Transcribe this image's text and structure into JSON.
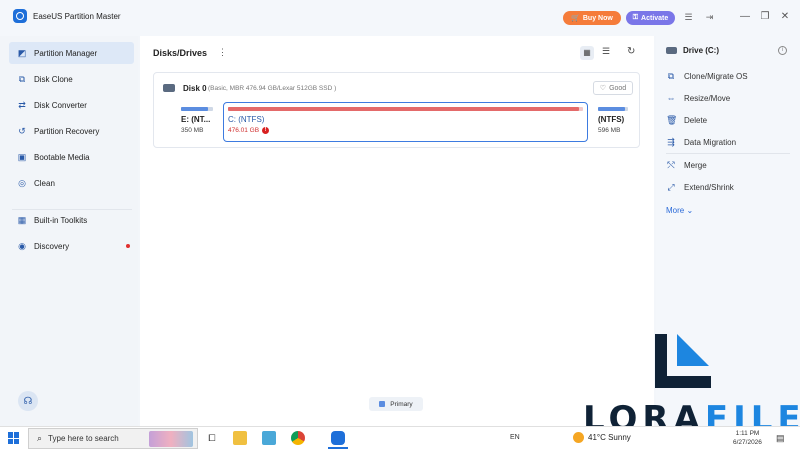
{
  "window": {
    "title": "EaseUS Partition Master",
    "buy_label": "Buy Now",
    "activate_label": "Activate"
  },
  "sidebar": {
    "items": [
      {
        "label": "Partition Manager",
        "icon": "partition-icon"
      },
      {
        "label": "Disk Clone",
        "icon": "clone-icon"
      },
      {
        "label": "Disk Converter",
        "icon": "converter-icon"
      },
      {
        "label": "Partition Recovery",
        "icon": "recovery-icon"
      },
      {
        "label": "Bootable Media",
        "icon": "media-icon"
      },
      {
        "label": "Clean",
        "icon": "clean-icon"
      },
      {
        "label": "Built-in Toolkits",
        "icon": "toolkit-icon"
      },
      {
        "label": "Discovery",
        "icon": "discovery-icon"
      }
    ]
  },
  "main": {
    "title": "Disks/Drives",
    "disk": {
      "name": "Disk 0",
      "info": "(Basic, MBR 476.94 GB/Lexar 512GB SSD )",
      "status": "Good",
      "partitions": [
        {
          "label": "E: (NT...",
          "size": "350 MB",
          "used": 0.85
        },
        {
          "label": "C: (NTFS)",
          "size": "476.01 GB",
          "used": 0.99
        },
        {
          "label": "(NTFS)",
          "size": "596 MB",
          "used": 0.9
        }
      ]
    },
    "legend": "Primary"
  },
  "right_panel": {
    "drive": "Drive (C:)",
    "actions": [
      {
        "label": "Clone/Migrate OS",
        "icon": "clone-os-icon"
      },
      {
        "label": "Resize/Move",
        "icon": "resize-icon"
      },
      {
        "label": "Delete",
        "icon": "trash-icon"
      },
      {
        "label": "Data Migration",
        "icon": "migration-icon"
      },
      {
        "label": "Merge",
        "icon": "merge-icon"
      },
      {
        "label": "Extend/Shrink",
        "icon": "extend-icon"
      }
    ],
    "more": "More"
  },
  "watermark": {
    "text_dark": "LORA",
    "text_blue": "FILE"
  },
  "taskbar": {
    "search_placeholder": "Type here to search",
    "lang": "EN",
    "weather": "41°C  Sunny",
    "time": "1:11 PM",
    "date": "6/27/2026"
  }
}
